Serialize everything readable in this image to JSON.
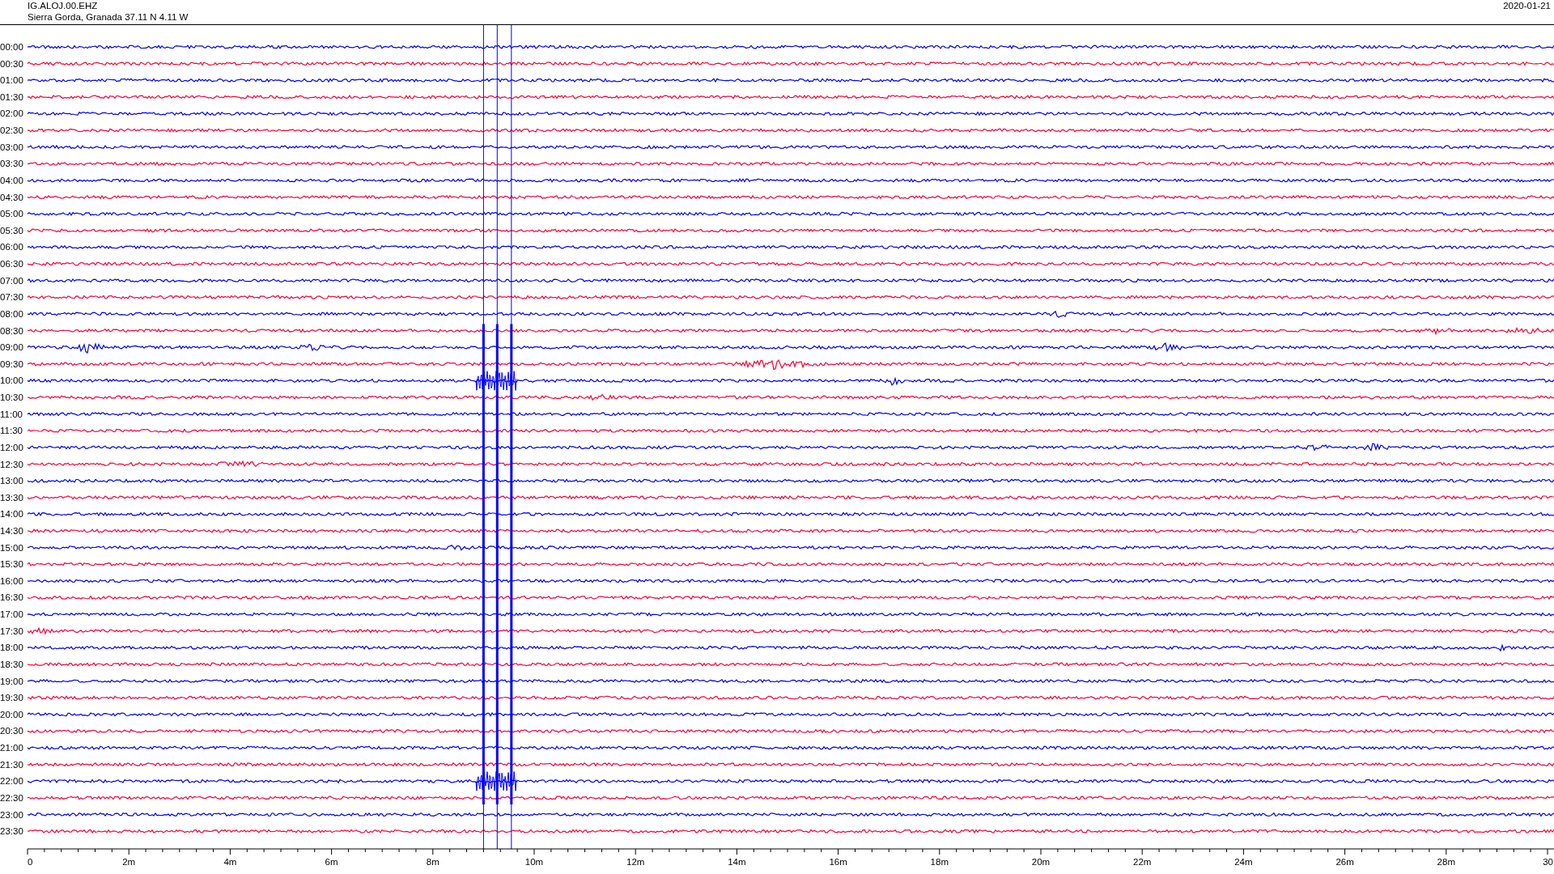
{
  "header": {
    "station": "IG.ALOJ.00.EHZ",
    "location": "Sierra Gorda, Granada  37.11 N 4.11 W",
    "date": "2020-01-21"
  },
  "traces": [
    {
      "label": "00:00",
      "color": "#0000ff"
    },
    {
      "label": "00:30",
      "color": "#ff0033"
    },
    {
      "label": "01:00",
      "color": "#0000ff"
    },
    {
      "label": "01:30",
      "color": "#ff0033"
    },
    {
      "label": "02:00",
      "color": "#0000ff"
    },
    {
      "label": "02:30",
      "color": "#ff0033"
    },
    {
      "label": "03:00",
      "color": "#0000ff"
    },
    {
      "label": "03:30",
      "color": "#ff0033"
    },
    {
      "label": "04:00",
      "color": "#0000ff"
    },
    {
      "label": "04:30",
      "color": "#ff0033"
    },
    {
      "label": "05:00",
      "color": "#0000ff"
    },
    {
      "label": "05:30",
      "color": "#ff0033"
    },
    {
      "label": "06:00",
      "color": "#0000ff"
    },
    {
      "label": "06:30",
      "color": "#ff0033"
    },
    {
      "label": "07:00",
      "color": "#0000ff"
    },
    {
      "label": "07:30",
      "color": "#ff0033"
    },
    {
      "label": "08:00",
      "color": "#0000ff"
    },
    {
      "label": "08:30",
      "color": "#ff0033"
    },
    {
      "label": "09:00",
      "color": "#0000ff"
    },
    {
      "label": "09:30",
      "color": "#ff0033"
    },
    {
      "label": "10:00",
      "color": "#0000ff"
    },
    {
      "label": "10:30",
      "color": "#ff0033"
    },
    {
      "label": "11:00",
      "color": "#0000ff"
    },
    {
      "label": "11:30",
      "color": "#ff0033"
    },
    {
      "label": "12:00",
      "color": "#0000ff"
    },
    {
      "label": "12:30",
      "color": "#ff0033"
    },
    {
      "label": "13:00",
      "color": "#0000ff"
    },
    {
      "label": "13:30",
      "color": "#ff0033"
    },
    {
      "label": "14:00",
      "color": "#0000ff"
    },
    {
      "label": "14:30",
      "color": "#ff0033"
    },
    {
      "label": "15:00",
      "color": "#0000ff"
    },
    {
      "label": "15:30",
      "color": "#ff0033"
    },
    {
      "label": "16:00",
      "color": "#0000ff"
    },
    {
      "label": "16:30",
      "color": "#ff0033"
    },
    {
      "label": "17:00",
      "color": "#0000ff"
    },
    {
      "label": "17:30",
      "color": "#ff0033"
    },
    {
      "label": "18:00",
      "color": "#0000ff"
    },
    {
      "label": "18:30",
      "color": "#ff0033"
    },
    {
      "label": "19:00",
      "color": "#0000ff"
    },
    {
      "label": "19:30",
      "color": "#ff0033"
    },
    {
      "label": "20:00",
      "color": "#0000ff"
    },
    {
      "label": "20:30",
      "color": "#ff0033"
    },
    {
      "label": "21:00",
      "color": "#0000ff"
    },
    {
      "label": "21:30",
      "color": "#ff0033"
    },
    {
      "label": "22:00",
      "color": "#0000ff"
    },
    {
      "label": "22:30",
      "color": "#ff0033"
    },
    {
      "label": "23:00",
      "color": "#0000ff"
    },
    {
      "label": "23:30",
      "color": "#ff0033"
    }
  ],
  "x_axis": {
    "tick_labels": [
      "0",
      "2m",
      "4m",
      "6m",
      "8m",
      "10m",
      "12m",
      "14m",
      "16m",
      "18m",
      "20m",
      "22m",
      "24m",
      "26m",
      "28m",
      "30"
    ]
  }
}
